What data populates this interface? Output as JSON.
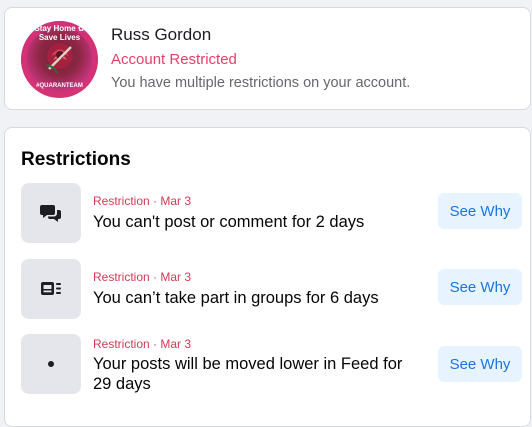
{
  "profile": {
    "name": "Russ Gordon",
    "status": "Account Restricted",
    "description": "You have multiple restrictions on your account.",
    "avatar_text_top": "Stay Home ✿ Save Lives",
    "avatar_text_bottom": "#QUARANTEAM"
  },
  "restrictions": {
    "title": "Restrictions",
    "items": [
      {
        "meta": "Restriction · Mar 3",
        "title": "You can't post or comment for 2 days",
        "icon": "chat-bubbles-icon",
        "button": "See Why"
      },
      {
        "meta": "Restriction · Mar 3",
        "title": "You can’t take part in groups for 6 days",
        "icon": "groups-feed-icon",
        "button": "See Why"
      },
      {
        "meta": "Restriction · Mar 3",
        "title": "Your posts will be moved lower in Feed for 29 days",
        "icon": "dot-icon",
        "button": "See Why"
      }
    ]
  },
  "colors": {
    "restricted": "#e4416a",
    "meta": "#d33a55",
    "button_bg": "#e7f3ff",
    "button_text": "#1b74e4",
    "icon_bg": "#e4e6eb"
  }
}
